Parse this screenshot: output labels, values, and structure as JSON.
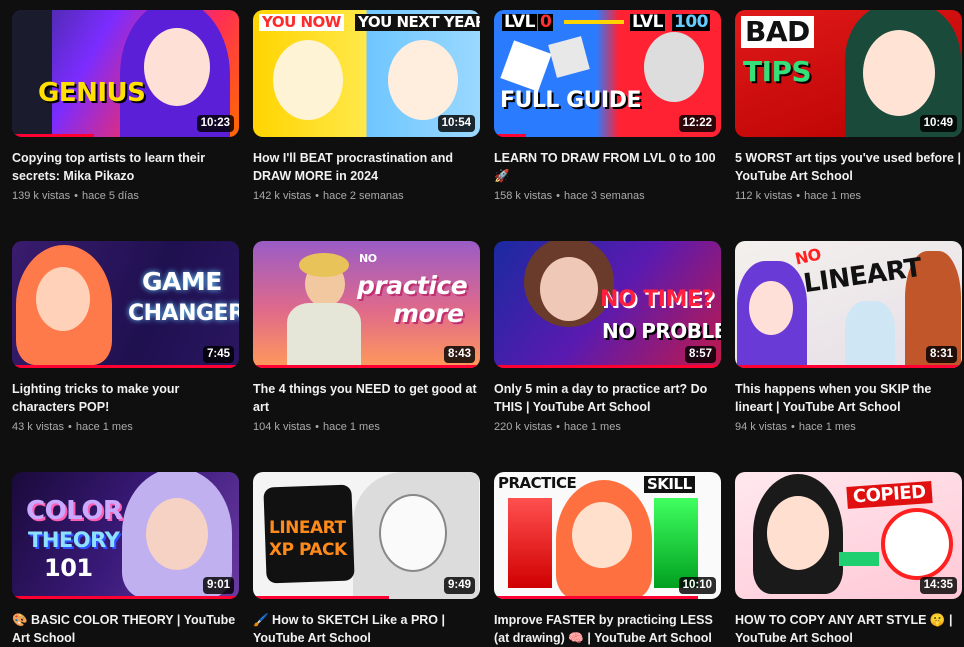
{
  "videos": [
    {
      "title": "Copying top artists to learn their secrets: Mika Pikazo",
      "views": "139 k vistas",
      "age": "hace 5 días",
      "duration": "10:23",
      "progress": 0.36,
      "thumb_text": [
        "GENIUS"
      ]
    },
    {
      "title": "How I'll BEAT procrastination and DRAW MORE in 2024",
      "views": "142 k vistas",
      "age": "hace 2 semanas",
      "duration": "10:54",
      "progress": 0,
      "thumb_text": [
        "YOU NOW",
        "YOU NEXT YEAR"
      ]
    },
    {
      "title": "LEARN TO DRAW FROM LVL 0 to 100 🚀",
      "views": "158 k vistas",
      "age": "hace 3 semanas",
      "duration": "12:22",
      "progress": 0.14,
      "thumb_text": [
        "LVL",
        "0",
        "LVL",
        "100",
        "FULL GUIDE"
      ]
    },
    {
      "title": "5 WORST art tips you've used before | YouTube Art School",
      "views": "112 k vistas",
      "age": "hace 1 mes",
      "duration": "10:49",
      "progress": 0,
      "thumb_text": [
        "BAD",
        "TIPS"
      ]
    },
    {
      "title": "Lighting tricks to make your characters POP!",
      "views": "43 k vistas",
      "age": "hace 1 mes",
      "duration": "7:45",
      "progress": 1,
      "thumb_text": [
        "GAME",
        "CHANGER"
      ]
    },
    {
      "title": "The 4 things you NEED to get good at art",
      "views": "104 k vistas",
      "age": "hace 1 mes",
      "duration": "8:43",
      "progress": 1,
      "thumb_text": [
        "NO",
        "practice",
        "more"
      ]
    },
    {
      "title": "Only 5 min a day to practice art? Do THIS | YouTube Art School",
      "views": "220 k vistas",
      "age": "hace 1 mes",
      "duration": "8:57",
      "progress": 1,
      "thumb_text": [
        "NO TIME?",
        "NO PROBLEM"
      ]
    },
    {
      "title": "This happens when you SKIP the lineart | YouTube Art School",
      "views": "94 k vistas",
      "age": "hace 1 mes",
      "duration": "8:31",
      "progress": 1,
      "thumb_text": [
        "NO",
        "LINEART"
      ]
    },
    {
      "title": "🎨 BASIC COLOR THEORY | YouTube Art School",
      "views": "",
      "age": "",
      "duration": "9:01",
      "progress": 1,
      "thumb_text": [
        "COLOR",
        "THEORY",
        "101"
      ]
    },
    {
      "title": "🖌️ How to SKETCH Like a PRO | YouTube Art School",
      "views": "",
      "age": "",
      "duration": "9:49",
      "progress": 0.6,
      "thumb_text": [
        "LINEART",
        "XP PACK"
      ]
    },
    {
      "title": "Improve FASTER by practicing LESS (at drawing) 🧠 | YouTube Art School",
      "views": "",
      "age": "",
      "duration": "10:10",
      "progress": 0.9,
      "thumb_text": [
        "PRACTICE",
        "SKILL"
      ]
    },
    {
      "title": "HOW TO COPY ANY ART STYLE 🤫 | YouTube Art School",
      "views": "",
      "age": "",
      "duration": "14:35",
      "progress": 0,
      "thumb_text": [
        "COPIED"
      ]
    }
  ],
  "colors": {
    "accent": "#ff0033",
    "meta": "#aaaaaa",
    "background": "#0f0f0f"
  }
}
